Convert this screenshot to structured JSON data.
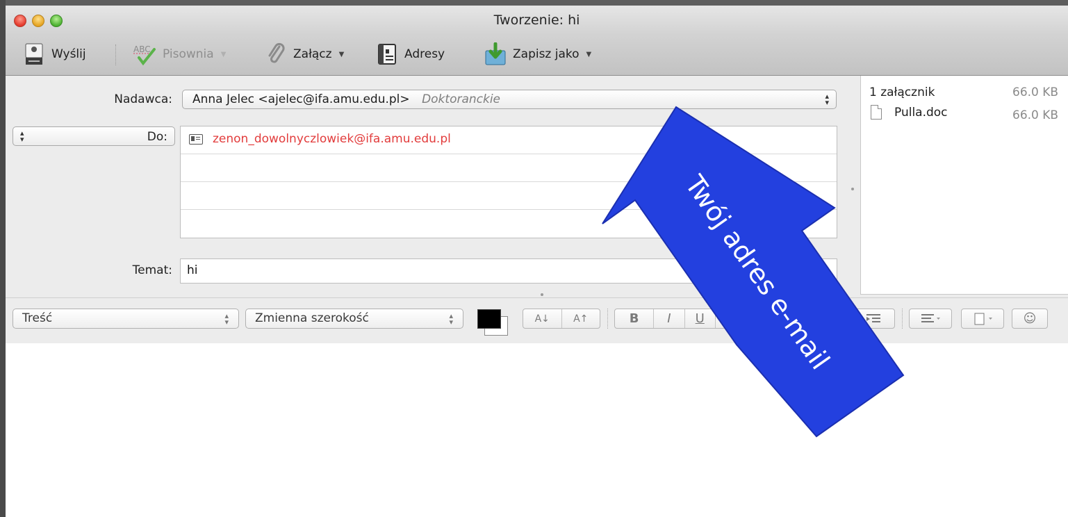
{
  "window": {
    "title": "Tworzenie: hi"
  },
  "toolbar": {
    "send_label": "Wyślij",
    "spelling_label": "Pisownia",
    "attach_label": "Załącz",
    "addresses_label": "Adresy",
    "save_as_label": "Zapisz jako",
    "dropdown_glyph": "▼"
  },
  "header": {
    "from_label": "Nadawca:",
    "from_value": "Anna Jelec <ajelec@ifa.amu.edu.pl>",
    "from_account": "Doktoranckie",
    "to_label": "Do:",
    "recipients": [
      "zenon_dowolnyczlowiek@ifa.amu.edu.pl"
    ],
    "subject_label": "Temat:",
    "subject_value": "hi"
  },
  "attachments": {
    "count_label": "1 załącznik",
    "total_size": "66.0 KB",
    "files": [
      {
        "name": "Pulla.doc",
        "size": "66.0 KB"
      }
    ]
  },
  "format_bar": {
    "paragraph_style": "Treść",
    "font_width": "Zmienna szerokość",
    "decrease_font": "A↓",
    "increase_font": "A↑",
    "bold": "B",
    "italic": "I",
    "underline": "U",
    "emoji_glyph": "☺"
  },
  "annotation": {
    "text": "Twój adres e-mail",
    "arrow_color": "#2340df"
  },
  "colors": {
    "recipient_red": "#e23c3c",
    "text_color_swatch": "#000000"
  }
}
